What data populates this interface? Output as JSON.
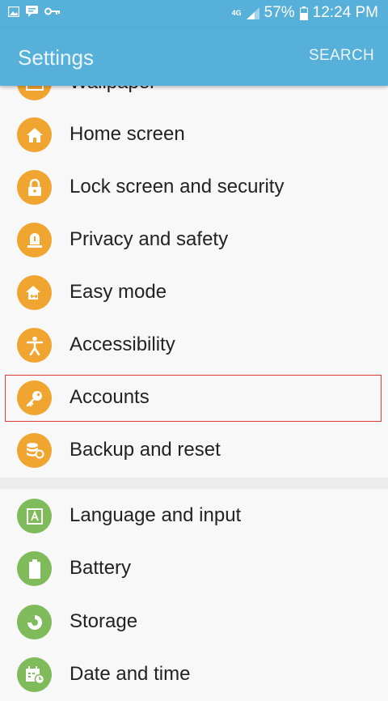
{
  "status_bar": {
    "network": "4G",
    "battery": "57%",
    "time": "12:24 PM"
  },
  "header": {
    "title": "Settings",
    "search_label": "SEARCH"
  },
  "items": [
    {
      "label": "Wallpaper",
      "icon": "wallpaper-icon",
      "color": "#f0a530"
    },
    {
      "label": "Home screen",
      "icon": "home-icon",
      "color": "#f0a530"
    },
    {
      "label": "Lock screen and security",
      "icon": "lock-icon",
      "color": "#f0a530"
    },
    {
      "label": "Privacy and safety",
      "icon": "alert-light-icon",
      "color": "#f0a530"
    },
    {
      "label": "Easy mode",
      "icon": "easy-mode-icon",
      "color": "#f0a530"
    },
    {
      "label": "Accessibility",
      "icon": "accessibility-icon",
      "color": "#f0a530"
    },
    {
      "label": "Accounts",
      "icon": "key-icon",
      "color": "#f0a530"
    },
    {
      "label": "Backup and reset",
      "icon": "backup-icon",
      "color": "#f0a530"
    },
    {
      "label": "Language and input",
      "icon": "language-icon",
      "color": "#7fba5b"
    },
    {
      "label": "Battery",
      "icon": "battery-icon",
      "color": "#7fba5b"
    },
    {
      "label": "Storage",
      "icon": "storage-icon",
      "color": "#7fba5b"
    },
    {
      "label": "Date and time",
      "icon": "date-time-icon",
      "color": "#7fba5b"
    }
  ]
}
